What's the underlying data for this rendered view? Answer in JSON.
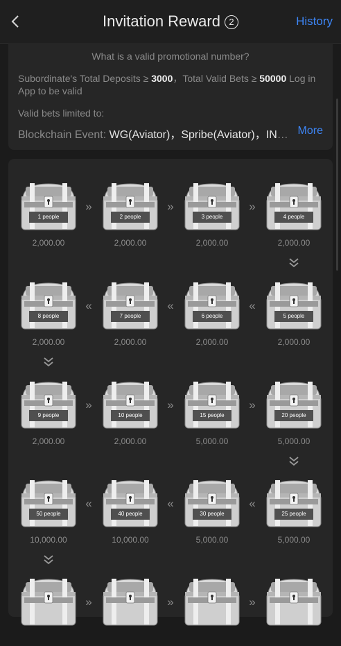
{
  "header": {
    "title": "Invitation Reward",
    "help_symbol": "2",
    "history_label": "History"
  },
  "info": {
    "question": "What is a valid promotional number?",
    "req_prefix": "Subordinate's Total Deposits ≥ ",
    "req_deposit": "3000",
    "req_mid": "，Total Valid Bets ≥ ",
    "req_bets": "50000",
    "req_suffix": " Log in App to be valid",
    "limited_label": "Valid bets limited to:",
    "event_label": "Blockchain Event: ",
    "event_value": "WG(Aviator)，Spribe(Aviator)，INO...",
    "more_label": "More"
  },
  "tiers": [
    {
      "label": "1 people",
      "amount": "2,000.00"
    },
    {
      "label": "2 people",
      "amount": "2,000.00"
    },
    {
      "label": "3 people",
      "amount": "2,000.00"
    },
    {
      "label": "4 people",
      "amount": "2,000.00"
    },
    {
      "label": "5 people",
      "amount": "2,000.00"
    },
    {
      "label": "6 people",
      "amount": "2,000.00"
    },
    {
      "label": "7 people",
      "amount": "2,000.00"
    },
    {
      "label": "8 people",
      "amount": "2,000.00"
    },
    {
      "label": "9 people",
      "amount": "2,000.00"
    },
    {
      "label": "10 people",
      "amount": "2,000.00"
    },
    {
      "label": "15 people",
      "amount": "5,000.00"
    },
    {
      "label": "20 people",
      "amount": "5,000.00"
    },
    {
      "label": "25 people",
      "amount": "5,000.00"
    },
    {
      "label": "30 people",
      "amount": "5,000.00"
    },
    {
      "label": "40 people",
      "amount": "10,000.00"
    },
    {
      "label": "50 people",
      "amount": "10,000.00"
    },
    {
      "label": "",
      "amount": ""
    },
    {
      "label": "",
      "amount": ""
    },
    {
      "label": "",
      "amount": ""
    },
    {
      "label": "",
      "amount": ""
    }
  ],
  "icons": {
    "back": "chevron-left-icon",
    "chest": "treasure-chest-icon",
    "right_arrow": "double-chevron-right-icon",
    "left_arrow": "double-chevron-left-icon",
    "down_arrow": "double-chevron-down-icon"
  },
  "colors": {
    "background": "#1b1b1b",
    "card": "#262626",
    "accent": "#3d86f6"
  }
}
